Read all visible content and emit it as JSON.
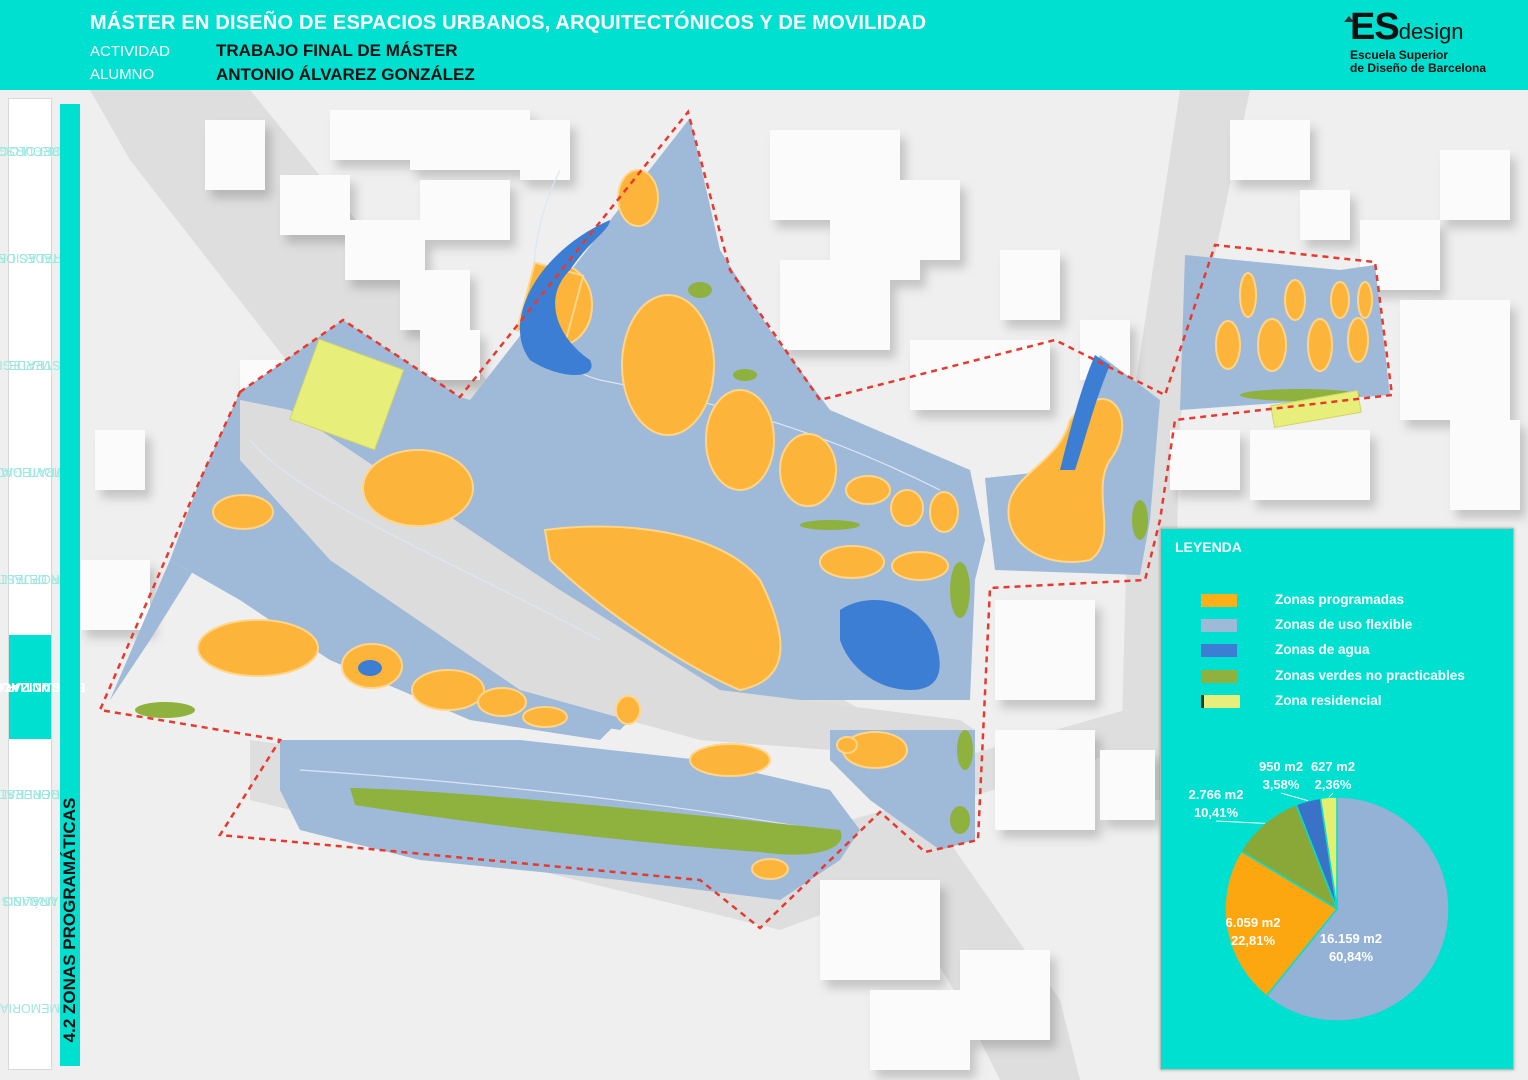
{
  "header": {
    "title": "MÁSTER EN DISEÑO DE ESPACIOS URBANOS, ARQUITECTÓNICOS Y DE MOVILIDAD",
    "activity_label": "ACTIVIDAD",
    "activity_value": "TRABAJO FINAL DE MÁSTER",
    "student_label": "ALUMNO",
    "student_value": "ANTONIO ÁLVAREZ GONZÁLEZ"
  },
  "logo": {
    "es": "ES",
    "design": "design",
    "line1": "Escuela Superior",
    "line2": "de Diseño de Barcelona"
  },
  "nav": {
    "items": [
      {
        "line1": "MORFOLOGÍA",
        "line2": "Y RECURSOS"
      },
      {
        "line1": "REDES DE",
        "line2": "INSTALACIONES"
      },
      {
        "line1": "ESTRATEGIA",
        "line2": "VERDE"
      },
      {
        "line1": "ESTRATEGIA DE",
        "line2": "MOVILIDAD"
      },
      {
        "line1": "PROPUESTA",
        "line2": "EN DETALLE"
      },
      {
        "line1": "ESTRUCTURA DE",
        "line2": "ORGANIZACIÓN"
      },
      {
        "line1": "PROPUESTA",
        "line2": "GENERAL"
      },
      {
        "line1": "ANÁLISIS",
        "line2": "URBANO"
      },
      {
        "line1": "MEMORIA",
        "line2": ""
      }
    ]
  },
  "section_title": "4.2 ZONAS PROGRAMÁTICAS",
  "legend": {
    "title": "LEYENDA",
    "items": [
      {
        "label": "Zonas programadas",
        "color": "#fcaf17"
      },
      {
        "label": "Zonas de uso flexible",
        "color": "#9fb9d8"
      },
      {
        "label": "Zonas de agua",
        "color": "#3c7ed4"
      },
      {
        "label": "Zonas verdes no practicables",
        "color": "#8fb13d"
      },
      {
        "label": "Zona residencial",
        "color": "#e8ee7a"
      }
    ]
  },
  "chart_data": {
    "type": "pie",
    "slices": [
      {
        "category": "Zonas de uso flexible",
        "value": 16159,
        "area": "16.159 m2",
        "percent": "60,84%",
        "color": "#93b2d6"
      },
      {
        "category": "Zonas programadas",
        "value": 6059,
        "area": "6.059 m2",
        "percent": "22,81%",
        "color": "#fca70f"
      },
      {
        "category": "Zonas verdes no practicables",
        "value": 2766,
        "area": "2.766 m2",
        "percent": "10,41%",
        "color": "#8aa838"
      },
      {
        "category": "Zonas de agua",
        "value": 950,
        "area": "950 m2",
        "percent": "3,58%",
        "color": "#3a72c8"
      },
      {
        "category": "Zona residencial",
        "value": 627,
        "area": "627 m2",
        "percent": "2,36%",
        "color": "#e6ee6e"
      }
    ]
  }
}
